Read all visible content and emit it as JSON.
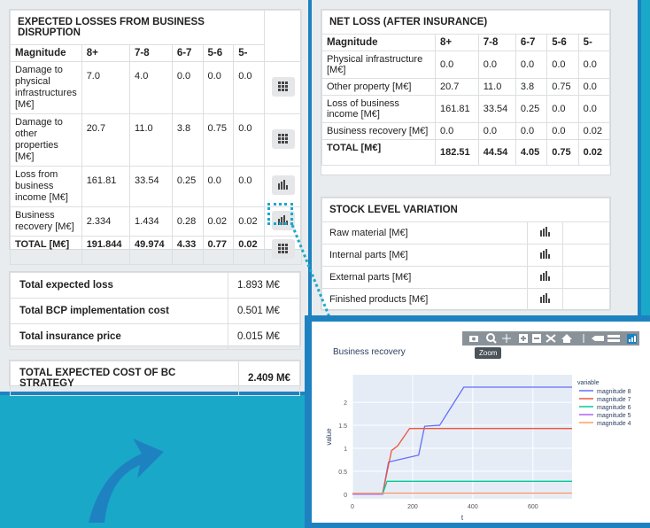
{
  "losses": {
    "title": "EXPECTED LOSSES FROM BUSINESS DISRUPTION",
    "headers": [
      "Magnitude",
      "8+",
      "7-8",
      "6-7",
      "5-6",
      "5-"
    ],
    "rows": [
      {
        "label": "Damage to physical infrastructures [M€]",
        "values": [
          "7.0",
          "4.0",
          "0.0",
          "0.0",
          "0.0"
        ],
        "icon": "grid-icon"
      },
      {
        "label": "Damage to other properties [M€]",
        "values": [
          "20.7",
          "11.0",
          "3.8",
          "0.75",
          "0.0"
        ],
        "icon": "grid-icon"
      },
      {
        "label": "Loss from business income [M€]",
        "values": [
          "161.81",
          "33.54",
          "0.25",
          "0.0",
          "0.0"
        ],
        "icon": "bar-chart-icon"
      },
      {
        "label": "Business recovery [M€]",
        "values": [
          "2.334",
          "1.434",
          "0.28",
          "0.02",
          "0.02"
        ],
        "icon": "bar-chart-icon"
      }
    ],
    "total": {
      "label": "TOTAL [M€]",
      "values": [
        "191.844",
        "49.974",
        "4.33",
        "0.77",
        "0.02"
      ]
    }
  },
  "summary": {
    "rows": [
      {
        "label": "Total expected loss",
        "value": "1.893 M€"
      },
      {
        "label": "Total BCP implementation cost",
        "value": "0.501 M€"
      },
      {
        "label": "Total insurance price",
        "value": "0.015 M€"
      }
    ],
    "strategy": {
      "label": "TOTAL EXPECTED COST OF BC STRATEGY",
      "value": "2.409 M€"
    }
  },
  "netloss": {
    "title": "NET LOSS (AFTER INSURANCE)",
    "headers": [
      "Magnitude",
      "8+",
      "7-8",
      "6-7",
      "5-6",
      "5-"
    ],
    "rows": [
      {
        "label": "Physical infrastructure [M€]",
        "values": [
          "0.0",
          "0.0",
          "0.0",
          "0.0",
          "0.0"
        ]
      },
      {
        "label": "Other property [M€]",
        "values": [
          "20.7",
          "11.0",
          "3.8",
          "0.75",
          "0.0"
        ]
      },
      {
        "label": "Loss of business income [M€]",
        "values": [
          "161.81",
          "33.54",
          "0.25",
          "0.0",
          "0.0"
        ]
      },
      {
        "label": "Business recovery [M€]",
        "values": [
          "0.0",
          "0.0",
          "0.0",
          "0.0",
          "0.02"
        ]
      }
    ],
    "total": {
      "label": "TOTAL [M€]",
      "values": [
        "182.51",
        "44.54",
        "4.05",
        "0.75",
        "0.02"
      ]
    }
  },
  "stock": {
    "title": "STOCK LEVEL VARIATION",
    "rows": [
      "Raw material [M€]",
      "Internal parts [M€]",
      "External parts [M€]",
      "Finished products [M€]"
    ]
  },
  "tooltip": "Zoom",
  "chart_data": {
    "type": "line",
    "title": "Business recovery",
    "xlabel": "t",
    "ylabel": "value",
    "xlim": [
      0,
      730
    ],
    "ylim": [
      -0.1,
      2.6
    ],
    "xticks": [
      0,
      200,
      400,
      600
    ],
    "yticks": [
      0,
      0.5,
      1,
      1.5,
      2
    ],
    "legend_title": "variable",
    "legend_position": "right",
    "grid": true,
    "series": [
      {
        "name": "magnitude 8",
        "color": "#636efa",
        "x": [
          0,
          100,
          120,
          220,
          240,
          290,
          370,
          730
        ],
        "y": [
          0,
          0,
          0.7,
          0.85,
          1.48,
          1.5,
          2.33,
          2.33
        ]
      },
      {
        "name": "magnitude 7",
        "color": "#ef553b",
        "x": [
          0,
          100,
          130,
          150,
          190,
          210,
          730
        ],
        "y": [
          0,
          0,
          0.95,
          1.05,
          1.43,
          1.43,
          1.43
        ]
      },
      {
        "name": "magnitude 6",
        "color": "#00cc96",
        "x": [
          0,
          100,
          115,
          730
        ],
        "y": [
          0,
          0,
          0.28,
          0.28
        ]
      },
      {
        "name": "magnitude 5",
        "color": "#ab63fa",
        "x": [
          0,
          100,
          105,
          730
        ],
        "y": [
          0,
          0,
          0.02,
          0.02
        ]
      },
      {
        "name": "magnitude 4",
        "color": "#ffa15a",
        "x": [
          0,
          730
        ],
        "y": [
          0.02,
          0.02
        ]
      }
    ]
  },
  "colors": {
    "accent": "#1e82c1",
    "background": "#1aa8c9"
  }
}
